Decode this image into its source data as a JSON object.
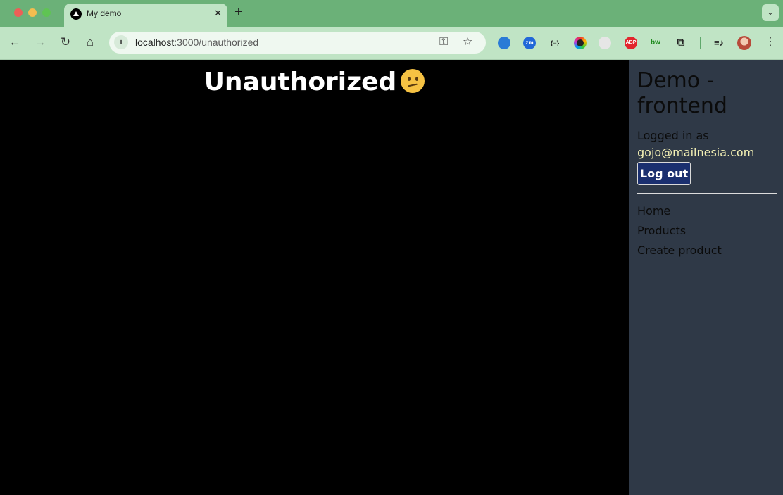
{
  "browser": {
    "tab": {
      "title": "My demo",
      "close": "✕"
    },
    "new_tab": "+",
    "tab_search": "⌄",
    "url": {
      "host": "localhost",
      "rest": ":3000/unauthorized"
    },
    "nav": {
      "back": "←",
      "forward": "→",
      "reload": "↻",
      "home": "⌂"
    },
    "site_info": "i",
    "key_icon": "⚿",
    "star_icon": "☆",
    "extensions": [
      "",
      "zm",
      "{≡}",
      "",
      "",
      "ABP",
      "bw",
      "⧉",
      "≡♪"
    ],
    "menu": "⋮"
  },
  "main": {
    "title": "Unauthorized"
  },
  "sidebar": {
    "brand": "Demo - frontend",
    "logged_in_label": "Logged in as",
    "email": "gojo@mailnesia.com",
    "logout_label": "Log out",
    "nav": [
      {
        "label": "Home"
      },
      {
        "label": "Products"
      },
      {
        "label": "Create product"
      }
    ]
  },
  "colors": {
    "tabbar": "#6bb178",
    "toolbar": "#c0e4c5",
    "page_background": "#000000",
    "sidebar_background": "#2f3947",
    "email_color": "#f3f0b4",
    "logout_button": "#1a2f6f"
  }
}
